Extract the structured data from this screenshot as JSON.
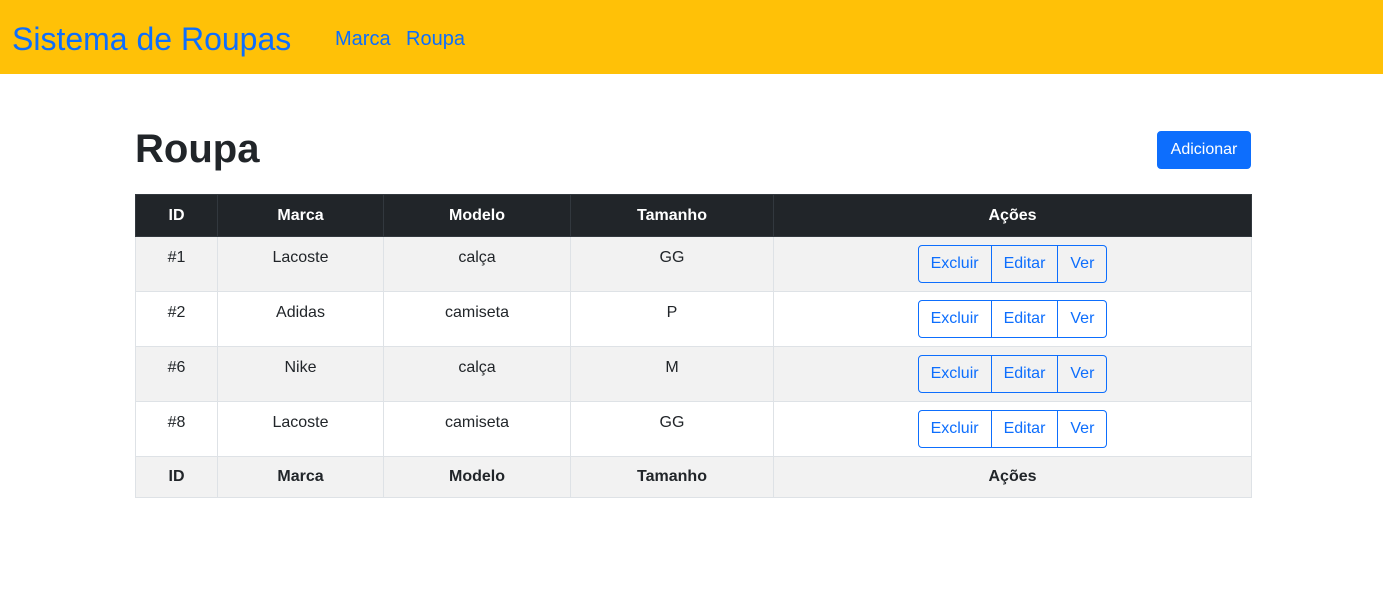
{
  "navbar": {
    "brand": "Sistema de Roupas",
    "links": [
      "Marca",
      "Roupa"
    ],
    "background_color": "#ffc107",
    "link_color": "#0d6efd"
  },
  "page": {
    "title": "Roupa",
    "add_button_label": "Adicionar"
  },
  "table": {
    "headers": [
      "ID",
      "Marca",
      "Modelo",
      "Tamanho",
      "Ações"
    ],
    "footer": [
      "ID",
      "Marca",
      "Modelo",
      "Tamanho",
      "Ações"
    ],
    "rows": [
      {
        "id": "#1",
        "marca": "Lacoste",
        "modelo": "calça",
        "tamanho": "GG"
      },
      {
        "id": "#2",
        "marca": "Adidas",
        "modelo": "camiseta",
        "tamanho": "P"
      },
      {
        "id": "#6",
        "marca": "Nike",
        "modelo": "calça",
        "tamanho": "M"
      },
      {
        "id": "#8",
        "marca": "Lacoste",
        "modelo": "camiseta",
        "tamanho": "GG"
      }
    ],
    "row_actions": [
      "Excluir",
      "Editar",
      "Ver"
    ]
  }
}
